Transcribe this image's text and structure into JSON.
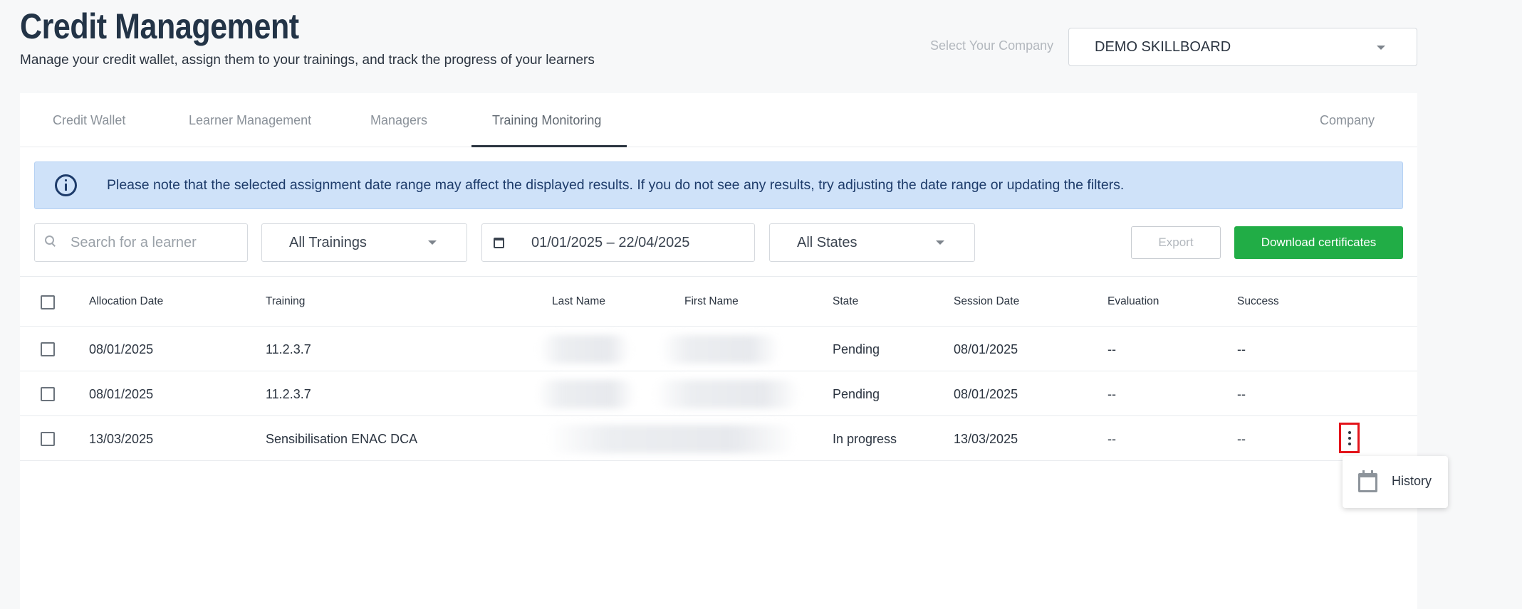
{
  "header": {
    "title": "Credit Management",
    "subtitle": "Manage your credit wallet, assign them to your trainings, and track the progress of your learners"
  },
  "company": {
    "label": "Select Your Company",
    "selected": "DEMO SKILLBOARD"
  },
  "tabs": [
    {
      "label": "Credit Wallet",
      "active": false
    },
    {
      "label": "Learner Management",
      "active": false
    },
    {
      "label": "Managers",
      "active": false
    },
    {
      "label": "Training Monitoring",
      "active": true
    },
    {
      "label": "Company",
      "active": false
    }
  ],
  "notice": {
    "icon": "info-icon",
    "text": "Please note that the selected assignment date range may affect the displayed results. If you do not see any results, try adjusting the date range or updating the filters."
  },
  "filters": {
    "search_placeholder": "Search for a learner",
    "trainings": "All Trainings",
    "date_range": "01/01/2025 – 22/04/2025",
    "states": "All States"
  },
  "actions": {
    "export": "Export",
    "download": "Download certificates"
  },
  "table": {
    "columns": [
      "Allocation Date",
      "Training",
      "Last Name",
      "First Name",
      "State",
      "Session Date",
      "Evaluation",
      "Success"
    ],
    "rows": [
      {
        "allocation_date": "08/01/2025",
        "training": "11.2.3.7",
        "state": "Pending",
        "session_date": "08/01/2025",
        "evaluation": "--",
        "success": "--"
      },
      {
        "allocation_date": "08/01/2025",
        "training": "11.2.3.7",
        "state": "Pending",
        "session_date": "08/01/2025",
        "evaluation": "--",
        "success": "--"
      },
      {
        "allocation_date": "13/03/2025",
        "training": "Sensibilisation ENAC DCA",
        "state": "In progress",
        "session_date": "13/03/2025",
        "evaluation": "--",
        "success": "--"
      }
    ]
  },
  "row_menu": {
    "items": [
      {
        "label": "History",
        "icon": "calendar-icon"
      }
    ]
  },
  "colors": {
    "accent_green": "#21ad46",
    "notice_bg": "#cfe2f9",
    "highlight_red": "#e3141b"
  }
}
